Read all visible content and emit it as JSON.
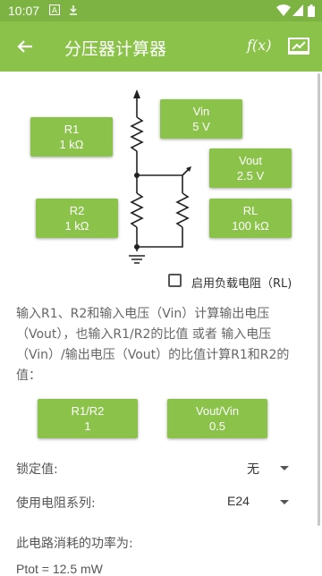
{
  "status_bar": {
    "time": "10:07",
    "icons": [
      "a-box-icon",
      "download-icon",
      "wifi-icon",
      "signal-icon",
      "battery-icon"
    ]
  },
  "app_bar": {
    "title": "分压器计算器",
    "fx_label": "f(x)",
    "icons": [
      "back-arrow-icon",
      "function-icon",
      "chart-icon"
    ]
  },
  "buttons": {
    "r1": {
      "name": "R1",
      "value": "1 kΩ"
    },
    "r2": {
      "name": "R2",
      "value": "1 kΩ"
    },
    "vin": {
      "name": "Vin",
      "value": "5 V"
    },
    "vout": {
      "name": "Vout",
      "value": "2.5 V"
    },
    "rl": {
      "name": "RL",
      "value": "100 kΩ"
    },
    "ratio_r": {
      "name": "R1/R2",
      "value": "1"
    },
    "ratio_v": {
      "name": "Vout/Vin",
      "value": "0.5"
    }
  },
  "load_checkbox": {
    "label": "启用负载电阻（RL)",
    "checked": false
  },
  "description": "输入R1、R2和输入电压（Vin）计算输出电压（Vout），也输入R1/R2的比值 或者 输入电压（Vin）/输出电压（Vout）的比值计算R1和R2的值：",
  "lock": {
    "label": "锁定值:",
    "value": "无"
  },
  "series": {
    "label": "使用电阻系列:",
    "value": "E24"
  },
  "power": {
    "label": "此电路消耗的功率为:",
    "value": "Ptot = 12.5 mW"
  },
  "colors": {
    "accent": "#8bc34a",
    "status_bar": "#7cb342"
  }
}
